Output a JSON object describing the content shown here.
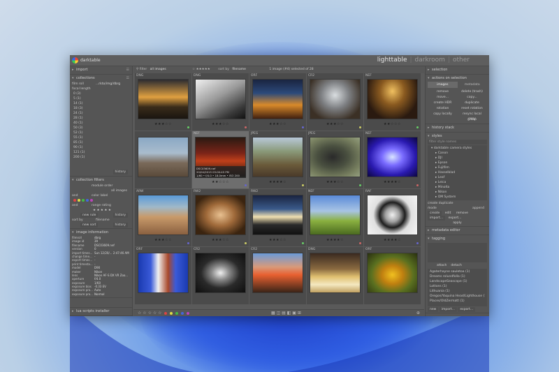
{
  "app": {
    "title": "darktable",
    "views": [
      "lighttable",
      "darkroom",
      "other"
    ]
  },
  "left": {
    "import_label": "import",
    "collections": {
      "label": "collections",
      "filters": [
        {
          "key": "film roll",
          "value": "...rkto/img/dbrg"
        },
        {
          "key": "focal length",
          "value": ""
        }
      ],
      "items": [
        "0 (3)",
        "5 (1)",
        "14 (1)",
        "18 (3)",
        "24 (1)",
        "28 (1)",
        "40 (1)",
        "50 (3)",
        "52 (1)",
        "55 (1)",
        "85 (1)",
        "90 (1)",
        "121 (1)",
        "200 (1)"
      ],
      "history_btn": "history"
    },
    "collection_filters": {
      "label": "collection filters",
      "rows": [
        {
          "left": "",
          "mid": "module order",
          "right": "all images"
        },
        {
          "left": "and",
          "mid": "color label",
          "right": ""
        },
        {
          "left": "and",
          "mid": "range rating",
          "right": "★ ★ ★ ★ ★"
        }
      ],
      "new_rule": "new rule",
      "history": "history",
      "sort_by": "sort by",
      "sort_val": "filename",
      "new_sort": "new sort",
      "history2": "history"
    },
    "image_info": {
      "label": "image information",
      "rows": [
        {
          "k": "filmroll",
          "v": "dbrg"
        },
        {
          "k": "image id",
          "v": "39"
        },
        {
          "k": "filename",
          "v": "DSC03609.nef"
        },
        {
          "k": "version",
          "v": "0"
        },
        {
          "k": "import times...",
          "v": "Sun 12/20/... 2:47:46 AM"
        },
        {
          "k": "change time...",
          "v": "-"
        },
        {
          "k": "export times...",
          "v": "-"
        },
        {
          "k": "print timesta...",
          "v": "-"
        },
        {
          "k": "model",
          "v": "D90"
        },
        {
          "k": "maker",
          "v": "Nikon"
        },
        {
          "k": "lens",
          "v": "Nikon AF-S DX VR Zoo..."
        },
        {
          "k": "aperture",
          "v": "f/4.0"
        },
        {
          "k": "exposure",
          "v": "1/60"
        },
        {
          "k": "exposure bias",
          "v": "-0.33 EV"
        },
        {
          "k": "exposure pro...",
          "v": "Auto"
        },
        {
          "k": "exposure pro...",
          "v": "Normal"
        }
      ]
    },
    "lua_label": "lua scripts installer"
  },
  "top": {
    "filter_label": "filter",
    "filter_value": "all images",
    "sort_label": "sort by",
    "sort_value": "filename",
    "count": "1 image (#4) selected of 28"
  },
  "thumbs": [
    {
      "type": "DNG",
      "stars": "★★★☆☆",
      "bg": "linear-gradient(180deg,#2b2b30 0%,#e0a040 45%,#3a2c1a 70%,#1a1510 100%)"
    },
    {
      "type": "DNG",
      "stars": "★★★☆☆",
      "bg": "linear-gradient(150deg,#f0f0f0 0%,#9a9a9a 45%,#3a3a3a 80%,#111 100%)"
    },
    {
      "type": "ORF",
      "stars": "★★★☆☆",
      "bg": "linear-gradient(180deg,#1a2440 0%,#2c4a7a 35%,#d98a2a 65%,#402010 100%)"
    },
    {
      "type": "CR2",
      "stars": "★★★☆☆",
      "bg": "radial-gradient(ellipse at 50% 40%,#d9dde0 0%,#7d7f82 40%,#3b3025 80%)"
    },
    {
      "type": "NEF",
      "stars": "★★☆☆☆",
      "bg": "radial-gradient(ellipse at 50% 30%,#f0c060 0%,#8a5a20 35%,#2a1a10 75%)"
    },
    {
      "type": "",
      "stars": "",
      "bg": "linear-gradient(180deg,#8aa8c4 0%,#a9bccd 40%,#7a6a5a 65%,#5a4a3a 100%)"
    },
    {
      "type": "NEF",
      "stars": "★★☆☆☆",
      "bg": "linear-gradient(180deg,#2a1a12 0%,#7a2418 40%,#c0401a 60%,#1a100c 100%)",
      "selected": true,
      "tip": {
        "name": "DSC03609.nef",
        "date": "20/04/2015 03:00:45 PM",
        "exif": "1/60 • f/4.0 • 18.0mm • ISO 200"
      }
    },
    {
      "type": "JPEG",
      "stars": "★★★★☆",
      "bg": "linear-gradient(180deg,#b8c8d8 0%,#8a9a7a 35%,#6a5a3a 70%,#4a3a2a 100%)"
    },
    {
      "type": "JPEG",
      "stars": "★★★☆☆",
      "bg": "radial-gradient(ellipse at 45% 50%,#2a2a2a 0%,#4a5040 40%,#788060 75%,#95a080 100%)"
    },
    {
      "type": "NEF",
      "stars": "★★★★☆",
      "bg": "radial-gradient(ellipse at 50% 50%,#d8e4ff 0%,#7a6cff 30%,#2a1ab0 65%,#0c0640 100%)"
    },
    {
      "type": "ARW",
      "stars": "★★★☆☆",
      "bg": "linear-gradient(180deg,#5a9ad8 0%,#a0b8c8 30%,#c89a6a 55%,#8a6040 100%)"
    },
    {
      "type": "RW2",
      "stars": "★★★☆☆",
      "bg": "radial-gradient(ellipse at 50% 50%,#e8c090 0%,#a06a3a 40%,#3a2410 80%)"
    },
    {
      "type": "RW2",
      "stars": "★★★☆☆",
      "bg": "linear-gradient(180deg,#1a2440 0%,#3a5a8a 35%,#f0e0b0 55%,#2a2a2a 75%,#111 100%)"
    },
    {
      "type": "NEF",
      "stars": "★★★★☆",
      "bg": "linear-gradient(180deg,#5a8ad8 0%,#a8c4e4 40%,#8ab040 65%,#4a6a20 100%)"
    },
    {
      "type": "RAF",
      "stars": "★★★★☆",
      "bg": "radial-gradient(circle at 50% 50%,#f0f0f0 0%,#a0a0a0 22%,#1e1e1e 40%,#e0e0e0 60%,#f4f4f4 100%)"
    },
    {
      "type": "ORF",
      "stars": "",
      "bg": "linear-gradient(90deg,#1a3ab0 0%,#3a5ad8 25%,#f0f0f0 40%,#a8482a 60%,#3a5ad8 75%,#1a3ab0 100%)"
    },
    {
      "type": "CR2",
      "stars": "",
      "bg": "radial-gradient(ellipse at 50% 50%,#f0f0f0 0%,#8a8a8a 25%,#2a2a2a 55%,#0e0e0e 100%)"
    },
    {
      "type": "CR2",
      "stars": "",
      "bg": "linear-gradient(180deg,#6a9ad8 0%,#d89a7a 35%,#e86030 55%,#3a2418 100%)"
    },
    {
      "type": "DNG",
      "stars": "",
      "bg": "linear-gradient(180deg,#3a2a20 0%,#8a6a40 40%,#e0c070 60%,#f4e8c0 80%,#c0a060 100%)"
    },
    {
      "type": "ORF",
      "stars": "",
      "bg": "radial-gradient(ellipse at 50% 55%,#f0c020 0%,#c08010 30%,#5a7020 60%,#2a3010 100%)"
    }
  ],
  "right": {
    "selection_label": "selection",
    "actions_label": "actions on selection",
    "tabs": [
      "images",
      "metadata"
    ],
    "buttons": [
      "remove",
      "delete (trash)",
      "move...",
      "copy...",
      "create HDR",
      "duplicate",
      "rotation",
      "reset rotation",
      "copy locally",
      "resync local copy",
      "",
      "group"
    ],
    "history_label": "history stack",
    "styles_label": "styles",
    "styles_search": "filter style names",
    "styles_tree": [
      {
        "t": "darktable camera styles",
        "top": true
      },
      {
        "t": "Canon"
      },
      {
        "t": "DJI"
      },
      {
        "t": "Epson"
      },
      {
        "t": "Fujifilm"
      },
      {
        "t": "Hasselblad"
      },
      {
        "t": "Leaf"
      },
      {
        "t": "Leica"
      },
      {
        "t": "Minolta"
      },
      {
        "t": "Nikon"
      },
      {
        "t": "OM System"
      }
    ],
    "create_dup": "create duplicate",
    "mode_label": "mode",
    "mode_val": "append",
    "create": "create",
    "edit": "edit",
    "remove": "remove",
    "import": "import...",
    "export": "export...",
    "apply": "apply",
    "metadata_editor": "metadata editor",
    "tagging": "tagging",
    "attach": "attach",
    "detach": "detach",
    "tags": [
      "Agaterhayne sauletoa (1)",
      "Dreams rolundfolla (1)",
      "LandscapeSeascape (1)",
      "Lottons (1)",
      "Lithuania (1)",
      "Oregon/Yaquina Head/Lighthouse (1)",
      "Places/OldZermatt (1)"
    ],
    "new": "new",
    "imp": "import...",
    "exp": "export..."
  }
}
